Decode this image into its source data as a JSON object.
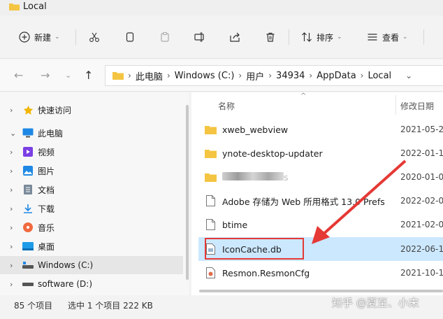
{
  "window": {
    "title": "Local"
  },
  "toolbar": {
    "new_label": "新建",
    "cut_icon": "scissors-icon",
    "sort_label": "排序",
    "view_label": "查看"
  },
  "address": {
    "crumbs": [
      "此电脑",
      "Windows (C:)",
      "用户",
      "34934",
      "AppData",
      "Local"
    ]
  },
  "navpane": {
    "items": [
      {
        "label": "快速访问",
        "icon": "star-icon",
        "color": "#f2b705"
      },
      {
        "label": "此电脑",
        "icon": "pc-icon",
        "color": "#1e88e5"
      },
      {
        "label": "视频",
        "icon": "video-icon",
        "color": "#7b3fe4"
      },
      {
        "label": "图片",
        "icon": "picture-icon",
        "color": "#1e88e5"
      },
      {
        "label": "文档",
        "icon": "document-icon",
        "color": "#7a8a99"
      },
      {
        "label": "下载",
        "icon": "download-icon",
        "color": "#1e88e5"
      },
      {
        "label": "音乐",
        "icon": "music-icon",
        "color": "#f06a3f"
      },
      {
        "label": "桌面",
        "icon": "desktop-icon",
        "color": "#1e9be8"
      },
      {
        "label": "Windows (C:)",
        "icon": "drive-icon",
        "color": "#555555"
      },
      {
        "label": "software (D:)",
        "icon": "drive-icon",
        "color": "#555555"
      }
    ]
  },
  "columns": {
    "name": "名称",
    "modified": "修改日期"
  },
  "files": [
    {
      "name": "xweb_webview",
      "date": "2021-05-2",
      "type": "folder"
    },
    {
      "name": "ynote-desktop-updater",
      "date": "2022-01-1",
      "type": "folder"
    },
    {
      "name": "s",
      "date": "2020-01-0",
      "type": "folder"
    },
    {
      "name": "Adobe 存储为 Web 所用格式 13.0 Prefs",
      "date": "2022-02-0",
      "type": "file"
    },
    {
      "name": "btime",
      "date": "2021-02-0",
      "type": "file"
    },
    {
      "name": "IconCache.db",
      "date": "2022-06-1",
      "type": "db"
    },
    {
      "name": "Resmon.ResmonCfg",
      "date": "2021-10-1",
      "type": "cfg"
    }
  ],
  "status": {
    "count": "85 个项目",
    "selection": "选中 1 个项目  222 KB"
  },
  "watermark": "知乎 @夏至、小末",
  "colors": {
    "selection": "#cce8ff",
    "highlight": "#e53935",
    "folder": "#f4c542"
  }
}
